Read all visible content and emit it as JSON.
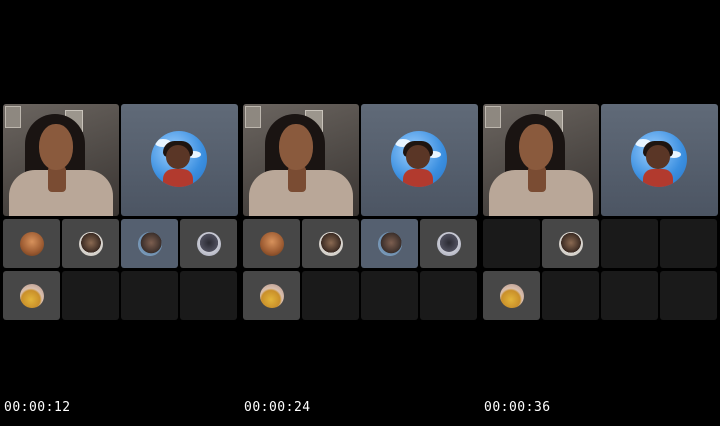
{
  "timestamps": [
    "00:00:12",
    "00:00:24",
    "00:00:36"
  ],
  "panels": [
    {
      "label": "frame-1",
      "avatars": [
        "a1",
        "a2",
        "a3",
        "a4",
        "a5"
      ]
    },
    {
      "label": "frame-2",
      "avatars": [
        "a1",
        "a2",
        "a3",
        "a4",
        "a5"
      ]
    },
    {
      "label": "frame-3",
      "avatars": [
        "a2",
        "a5"
      ]
    }
  ],
  "colors": {
    "background": "#000000",
    "tile": "#474747",
    "empty_tile": "#1a1a1a",
    "avatar_tile": "#556070"
  }
}
